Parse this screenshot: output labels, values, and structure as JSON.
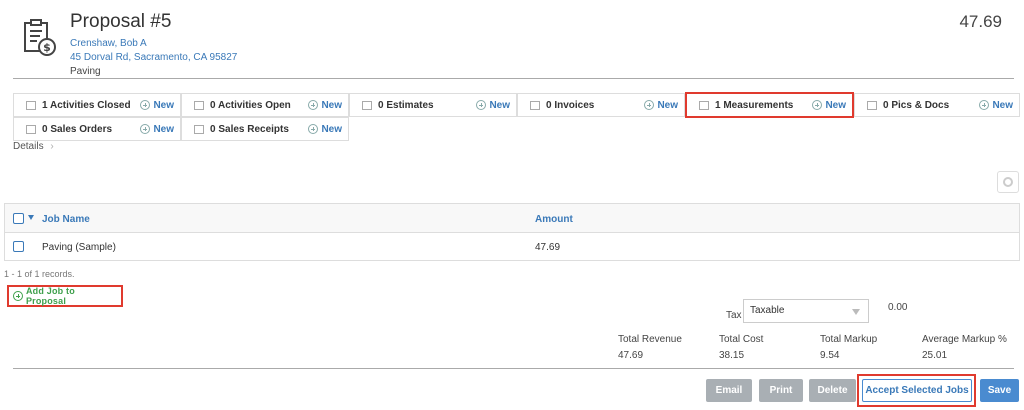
{
  "header": {
    "title": "Proposal #5",
    "amount": "47.69",
    "customer_name": "Crenshaw, Bob A",
    "customer_address": "45 Dorval Rd, Sacramento, CA 95827",
    "job_type": "Paving"
  },
  "tiles": [
    {
      "label": "1 Activities Closed",
      "new": "New"
    },
    {
      "label": "0 Activities Open",
      "new": "New"
    },
    {
      "label": "0 Estimates",
      "new": "New"
    },
    {
      "label": "0 Invoices",
      "new": "New"
    },
    {
      "label": "1 Measurements",
      "new": "New"
    },
    {
      "label": "0 Pics & Docs",
      "new": "New"
    },
    {
      "label": "0 Sales Orders",
      "new": "New"
    },
    {
      "label": "0 Sales Receipts",
      "new": "New"
    }
  ],
  "details_label": "Details",
  "grid": {
    "columns": [
      "Job Name",
      "Amount"
    ],
    "rows": [
      {
        "job_name": "Paving (Sample)",
        "amount": "47.69"
      }
    ],
    "records_text": "1 - 1 of 1 records."
  },
  "add_job_label": "Add Job to Proposal",
  "tax": {
    "label": "Tax",
    "selected": "Taxable",
    "amount": "0.00"
  },
  "totals": {
    "labels": [
      "Total Revenue",
      "Total Cost",
      "Total Markup",
      "Average Markup %"
    ],
    "values": [
      "47.69",
      "38.15",
      "9.54",
      "25.01"
    ]
  },
  "buttons": {
    "email": "Email",
    "print": "Print",
    "delete": "Delete",
    "accept": "Accept Selected Jobs",
    "save": "Save"
  },
  "colors": {
    "accent": "#3a79b8",
    "highlight": "#e03a2e",
    "add": "#3ea04c"
  }
}
